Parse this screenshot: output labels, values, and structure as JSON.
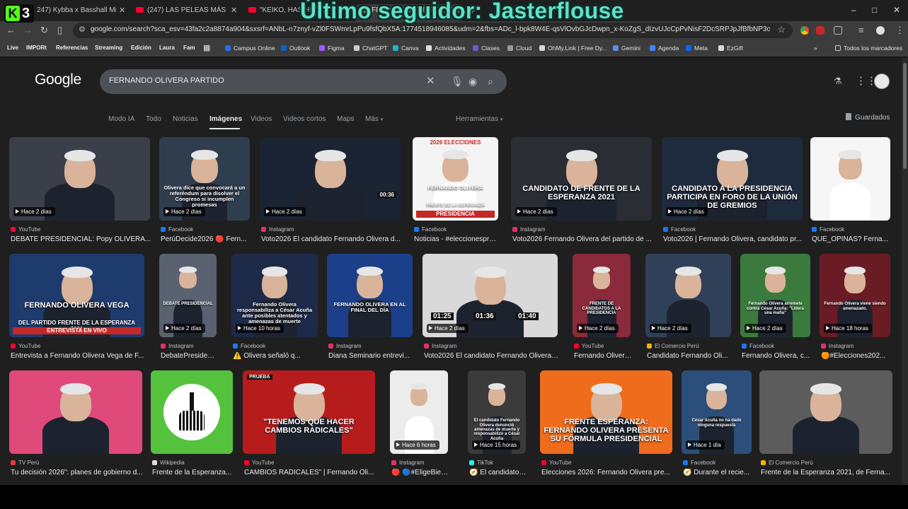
{
  "tabs": [
    {
      "title": "247) Kybba x Basshall Mix #6 |",
      "icon": "youtube-icon"
    },
    {
      "title": "(247) LAS PELEAS MÁS FUERTE",
      "icon": "youtube-icon"
    },
    {
      "title": "\"KEIKO, HAS HECHO DAÑO",
      "icon": "youtube-icon"
    },
    {
      "title": "FERNANDO OLIVERA PARTID",
      "icon": "google-icon"
    }
  ],
  "kick_logo": {
    "letter": "K",
    "number": "3"
  },
  "overlay_banner": "Último seguidor: Jasterflouse",
  "window_controls": {
    "minimize": "–",
    "maximize": "□",
    "close": "✕"
  },
  "url": "google.com/search?sca_esv=43fa2c2a8874a904&sxsrf=ANbL-n7znyf-vZl0FSWmrLpPu9fsfQbX5A:1774518946085&udm=2&fbs=ADc_l-bpk8W4E-qsVlOvbGJcDwpn_x-KoZgS_dIzvUJcCpPvNisF2DcSRPJpJfBfbNP3o4JLH6S20G8zOzPyQ...",
  "bookmarks_chips": [
    {
      "label": "Live",
      "color": "#3a7d2c"
    },
    {
      "label": "IMPORt",
      "color": "#4a4a4a"
    },
    {
      "label": "Referencias",
      "color": "#4a4a4a"
    },
    {
      "label": "Streaming",
      "color": "#3d5a8a"
    },
    {
      "label": "Edición",
      "color": "#7a6a22"
    },
    {
      "label": "Laura",
      "color": "#5a3c6a"
    },
    {
      "label": "Fam",
      "color": "#4a4a4a"
    }
  ],
  "bookmarks": [
    {
      "label": "Campus Online",
      "color": "#1f6feb"
    },
    {
      "label": "Outlook",
      "color": "#0a64c8"
    },
    {
      "label": "Figma",
      "color": "#a259ff"
    },
    {
      "label": "ChatGPT",
      "color": "#cfcfcf"
    },
    {
      "label": "Canva",
      "color": "#21b5c9"
    },
    {
      "label": "Actividades",
      "color": "#dedede"
    },
    {
      "label": "Clases",
      "color": "#6b5bd6"
    },
    {
      "label": "Cloud",
      "color": "#9a9a9a"
    },
    {
      "label": "OhMy.Link | Free Dy...",
      "color": "#d8d8d8"
    },
    {
      "label": "Gemini",
      "color": "#5b8def"
    },
    {
      "label": "Agenda",
      "color": "#4285f4"
    },
    {
      "label": "Meta",
      "color": "#0866ff"
    },
    {
      "label": "EzGift",
      "color": "#d9d9d9"
    }
  ],
  "all_bookmarks_label": "Todos los marcadores",
  "google": {
    "logo": "Google",
    "query": "FERNANDO OLIVERA PARTIDO",
    "filters": [
      "Modo IA",
      "Todo",
      "Noticias",
      "Imágenes",
      "Videos",
      "Videos cortos",
      "Maps",
      "Más"
    ],
    "active_filter": "Imágenes",
    "tools_label": "Herramientas",
    "saved_label": "Guardados"
  },
  "results_row1": [
    {
      "source": "YouTube",
      "title": "DEBATE PRESIDENCIAL: Popy OLIVERA...",
      "badge": "Hace 2 días",
      "fav": "#ff0033"
    },
    {
      "source": "Facebook",
      "title": "PerúDecide2026 🔴 Fern...",
      "badge": "Hace 2 días",
      "fav": "#1877f2",
      "banner": "Olivera dice que convocará a un referéndum para disolver el Congreso si incumplen promesas"
    },
    {
      "source": "Instagram",
      "title": "Voto2026 El candidato Fernando Olivera d...",
      "badge": "Hace 2 días",
      "fav": "#e1306c",
      "timer": "00:36"
    },
    {
      "source": "Facebook",
      "title": "Noticias - #eleccionespres...",
      "fav": "#1877f2",
      "banner_top": "2026 ELECCIONES",
      "banner": "FERNANDO OLIVERA",
      "banner2": "FRENTE DE LA ESPERANZA",
      "banner3": "PRESIDENCIA"
    },
    {
      "source": "Instagram",
      "title": "Voto2026 Fernando Olivera del partido de ...",
      "badge": "Hace 2 días",
      "fav": "#e1306c",
      "banner": "CANDIDATO DE FRENTE DE LA ESPERANZA 2021"
    },
    {
      "source": "Facebook",
      "title": "Voto2026 | Fernando Olivera, candidato pr...",
      "badge": "Hace 2 días",
      "fav": "#1877f2",
      "banner": "CANDIDATO A LA PRESIDENCIA PARTICIPA EN FORO DE LA UNIÓN DE GREMIOS"
    },
    {
      "source": "Facebook",
      "title": "QUÉ_OPINAS? Ferna...",
      "fav": "#1877f2"
    }
  ],
  "results_row2": [
    {
      "source": "YouTube",
      "title": "Entrevista a Fernando Olivera Vega de F...",
      "fav": "#ff0033",
      "banner": "FERNANDO OLIVERA VEGA",
      "banner2": "DEL PARTIDO FRENTE DE LA ESPERANZA 2021",
      "banner3": "ENTREVISTA EN VIVO"
    },
    {
      "source": "Instagram",
      "title": "DebatePresidencia...",
      "badge": "Hace 2 días",
      "fav": "#e1306c",
      "banner": "DEBATE PRESIDENCIAL"
    },
    {
      "source": "Facebook",
      "title": "⚠️ Olivera señaló q...",
      "badge": "Hace 10 horas",
      "fav": "#1877f2",
      "banner": "Fernando Olivera responsabiliza a César Acuña ante posibles atentados y amenazas de muerte"
    },
    {
      "source": "Instagram",
      "title": "Diana Seminario entrevi...",
      "fav": "#e1306c",
      "banner": "FERNANDO OLIVERA EN AL FINAL DEL DÍA"
    },
    {
      "source": "Instagram",
      "title": "Voto2026 El candidato Fernando Olivera ...",
      "badge": "Hace 2 días",
      "fav": "#e1306c",
      "timers": [
        "01:25",
        "01:36",
        "01:40"
      ]
    },
    {
      "source": "YouTube",
      "title": "Fernando Olivera ...",
      "badge": "Hace 2 días",
      "fav": "#ff0033",
      "banner": "FRENTE DE CANDIDATOS A LA PRESIDENCIA"
    },
    {
      "source": "El Comercio Perú",
      "title": "Candidato Fernando Oli...",
      "badge": "Hace 2 días",
      "fav": "#f2b705"
    },
    {
      "source": "Facebook",
      "title": "Fernando Olivera, c...",
      "badge": "Hace 2 días",
      "fav": "#1877f2",
      "banner": "Fernando Olivera arremete contra César Acuña: \"Lidera una mafia\""
    },
    {
      "source": "Instagram",
      "title": "🟠#Elecciones202...",
      "badge": "Hace 18 horas",
      "fav": "#e1306c",
      "banner": "Fernando Olivera viene siendo amenazado."
    }
  ],
  "results_row3": [
    {
      "source": "TV Perú",
      "title": "Tu decisión 2026\": planes de gobierno d...",
      "fav": "#e53935"
    },
    {
      "source": "Wikipedia",
      "title": "Frente de la Esperanza...",
      "fav": "#dddddd"
    },
    {
      "source": "YouTube",
      "title": "CAMBIOS RADICALES\" | Fernando Oli...",
      "fav": "#ff0033",
      "banner": "\"TENEMOS QUE HACER CAMBIOS RADICALES\"",
      "tag": "PRUEBA"
    },
    {
      "source": "Instagram",
      "title": "🔴 🔵#EligeBien ✓...",
      "badge": "Hace 6 horas",
      "fav": "#e1306c"
    },
    {
      "source": "TikTok",
      "title": "🧭 El candidato F...",
      "badge": "Hace 15 horas",
      "fav": "#25f4ee",
      "banner": "El candidato Fernando Olivera denunció amenazas de muerte y responsabilizó a César Acuña"
    },
    {
      "source": "YouTube",
      "title": "Elecciones 2026: Fernando Olivera pre...",
      "fav": "#ff0033",
      "banner": "FRENTE ESPERANZA: FERNANDO OLIVERA PRESENTA SU FÓRMULA PRESIDENCIAL"
    },
    {
      "source": "Facebook",
      "title": "🧭 Durante el recie...",
      "badge": "Hace 1 día",
      "fav": "#1877f2",
      "banner": "César Acuña no ha dado ninguna respuesta"
    },
    {
      "source": "El Comercio Perú",
      "title": "Frente de la Esperanza 2021, de Ferna...",
      "fav": "#f2b705"
    }
  ]
}
